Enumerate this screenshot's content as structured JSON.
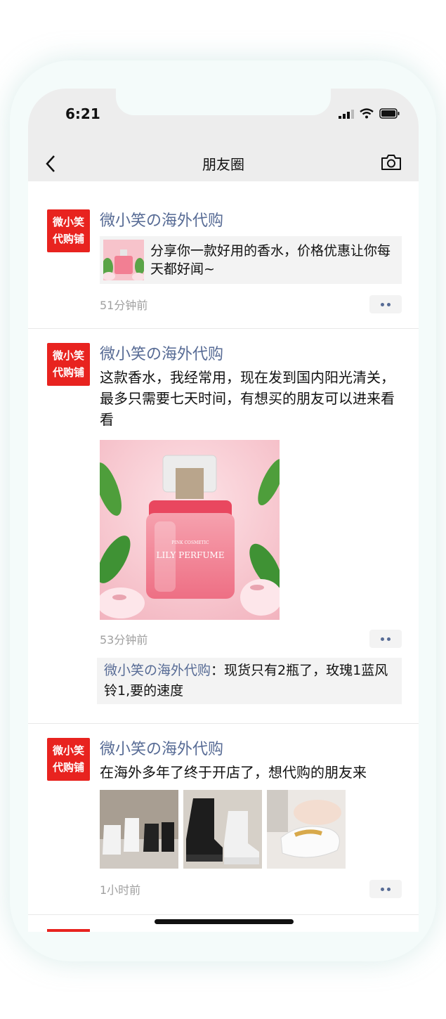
{
  "status": {
    "time": "6:21"
  },
  "nav": {
    "title": "朋友圈"
  },
  "avatar_text": {
    "line1": "微小笑",
    "line2": "代购铺"
  },
  "posts": [
    {
      "user": "微小笑の海外代购",
      "share_text": "分享你一款好用的香水，价格优惠让你每天都好闻~",
      "time": "51分钟前"
    },
    {
      "user": "微小笑の海外代购",
      "text": "这款香水，我经常用，现在发到国内阳光清关，最多只需要七天时间，有想买的朋友可以进来看看",
      "image_label_small": "PINK COSMETIC",
      "image_label": "LILY PERFUME",
      "time": "53分钟前",
      "comment": {
        "name": "微小笑の海外代购",
        "separator": "：",
        "text": "现货只有2瓶了，玫瑰1蓝风铃1,要的速度"
      }
    },
    {
      "user": "微小笑の海外代购",
      "text": "在海外多年了终于开店了，想代购的朋友来",
      "time": "1小时前"
    }
  ],
  "colors": {
    "link": "#576b95",
    "avatar_bg": "#e8231f",
    "bar_bg": "#ededed"
  }
}
